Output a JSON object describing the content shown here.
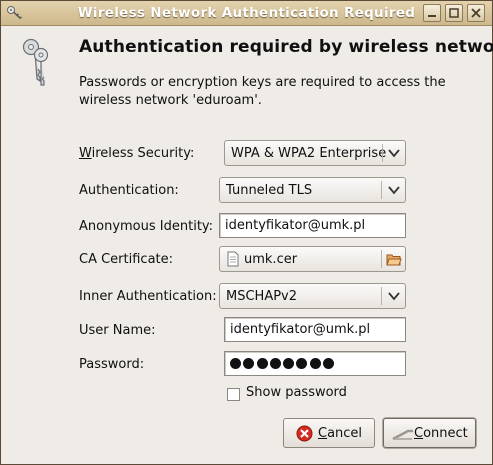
{
  "window": {
    "title": "Wireless Network Authentication Required"
  },
  "dialog": {
    "heading": "Authentication required by wireless network",
    "description": "Passwords or encryption keys are required to access the wireless network 'eduroam'."
  },
  "form": {
    "wireless_security": {
      "label_mnemonic": "W",
      "label_rest": "ireless Security:",
      "value": "WPA & WPA2 Enterprise"
    },
    "authentication": {
      "label": "Authentication:",
      "value": "Tunneled TLS"
    },
    "anonymous_identity": {
      "label": "Anonymous Identity:",
      "value": "identyfikator@umk.pl"
    },
    "ca_certificate": {
      "label": "CA Certificate:",
      "value": "umk.cer"
    },
    "inner_authentication": {
      "label": "Inner Authentication:",
      "value": "MSCHAPv2"
    },
    "user_name": {
      "label": "User Name:",
      "value": "identyfikator@umk.pl"
    },
    "password": {
      "label": "Password:",
      "masked_length": 8
    },
    "show_password": {
      "label": "Show password",
      "checked": false
    }
  },
  "buttons": {
    "cancel": {
      "mnemonic": "C",
      "rest": "ancel"
    },
    "connect": {
      "mnemonic": "C",
      "rest": "onnect"
    }
  },
  "icons": {
    "title": "keys-icon",
    "dialog": "keys-icon",
    "cancel": "cancel-icon",
    "connect": "connect-icon",
    "file": "file-icon",
    "open": "open-folder-icon"
  }
}
